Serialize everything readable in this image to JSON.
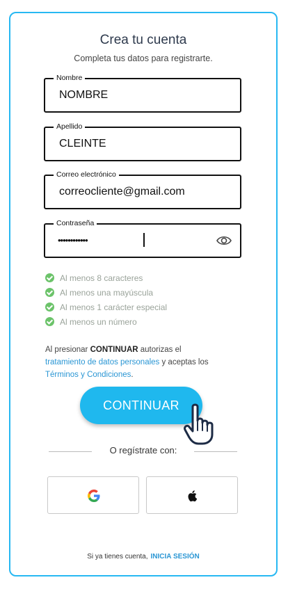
{
  "header": {
    "title": "Crea tu cuenta",
    "subtitle": "Completa tus datos para registrarte."
  },
  "form": {
    "first_name": {
      "label": "Nombre",
      "value": "NOMBRE"
    },
    "last_name": {
      "label": "Apellido",
      "value": "CLEINTE"
    },
    "email": {
      "label": "Correo electrónico",
      "value": "correocliente@gmail.com"
    },
    "password": {
      "label": "Contraseña",
      "masked_value": "••••••••••••",
      "toggle_icon": "eye-icon"
    }
  },
  "password_rules": [
    {
      "text": "Al menos 8 caracteres",
      "met": true
    },
    {
      "text": "Al menos una mayúscula",
      "met": true
    },
    {
      "text": "Al menos 1 carácter especial",
      "met": true
    },
    {
      "text": "Al menos un número",
      "met": true
    }
  ],
  "consent": {
    "prefix": "Al presionar ",
    "bold": "CONTINUAR",
    "middle": " autorizas el ",
    "link1": "tratamiento de datos personales",
    "between": " y aceptas los ",
    "link2": "Términos y Condiciones",
    "suffix": "."
  },
  "continue_button": {
    "label": "CONTINUAR"
  },
  "alt_signup": {
    "label": "O regístrate con:",
    "providers": [
      {
        "name": "google-icon"
      },
      {
        "name": "apple-icon"
      }
    ]
  },
  "footer": {
    "text": "Si ya tienes cuenta,",
    "link": "INICIA SESIÓN"
  },
  "colors": {
    "accent": "#1fb8ee",
    "border": "#27b8f2",
    "check": "#6cc36a",
    "link": "#2a96d4"
  }
}
